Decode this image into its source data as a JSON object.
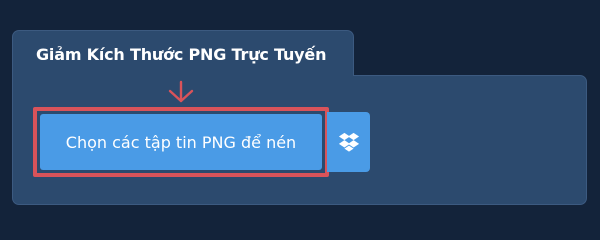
{
  "tab": {
    "title": "Giảm Kích Thước PNG Trực Tuyến"
  },
  "upload": {
    "button_label": "Chọn các tập tin PNG để nén"
  },
  "icons": {
    "arrow": "arrow-down-icon",
    "dropbox": "dropbox-icon"
  },
  "colors": {
    "background": "#13233a",
    "panel": "#2c4a6e",
    "button": "#4a9be6",
    "highlight": "#d9535a"
  }
}
